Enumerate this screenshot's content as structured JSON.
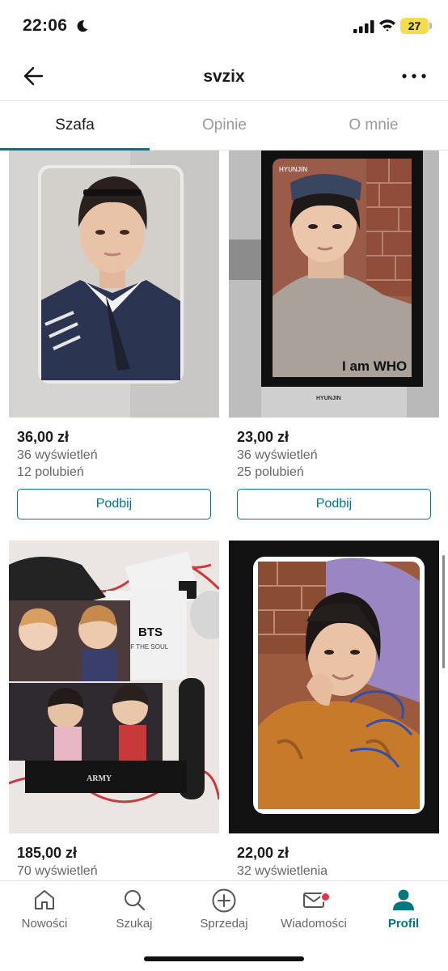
{
  "status_bar": {
    "time": "22:06",
    "battery": "27"
  },
  "header": {
    "title": "svzix"
  },
  "tabs": [
    {
      "label": "Szafa",
      "active": true
    },
    {
      "label": "Opinie",
      "active": false
    },
    {
      "label": "O mnie",
      "active": false
    }
  ],
  "items": [
    {
      "price": "36,00 zł",
      "views": "36 wyświetleń",
      "likes": "12 polubień",
      "button": "Podbij"
    },
    {
      "price": "23,00 zł",
      "views": "36 wyświetleń",
      "likes": "25 polubień",
      "button": "Podbij",
      "photo_text": [
        "HYUNJIN",
        "I am WHO",
        "HYUNJIN"
      ]
    },
    {
      "price": "185,00 zł",
      "views": "70 wyświetleń",
      "photo_text": [
        "BTS",
        "OF THE SOUL",
        "ARMY"
      ]
    },
    {
      "price": "22,00 zł",
      "views": "32 wyświetlenia"
    }
  ],
  "bottom_nav": [
    {
      "label": "Nowości",
      "icon": "home-icon"
    },
    {
      "label": "Szukaj",
      "icon": "search-icon"
    },
    {
      "label": "Sprzedaj",
      "icon": "plus-circle-icon"
    },
    {
      "label": "Wiadomości",
      "icon": "mail-icon",
      "badge": true
    },
    {
      "label": "Profil",
      "icon": "profile-icon",
      "active": true
    }
  ],
  "colors": {
    "accent": "#007782",
    "badge": "#e5334b",
    "battery": "#f4dc4e"
  }
}
